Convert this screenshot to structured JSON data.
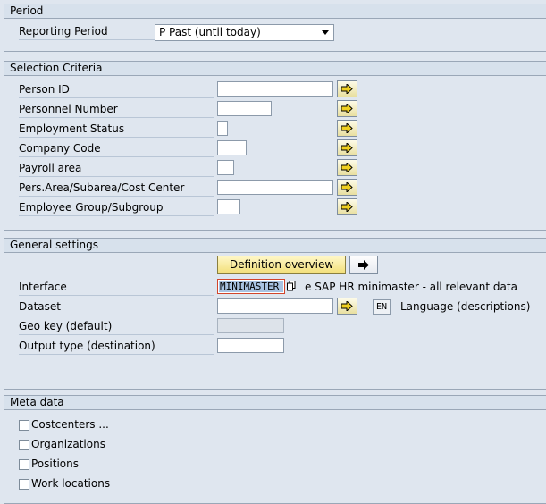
{
  "period": {
    "title": "Period",
    "reporting_period_label": "Reporting Period",
    "reporting_period_value": "P Past (until today)"
  },
  "selection": {
    "title": "Selection Criteria",
    "fields": [
      {
        "label": "Person ID",
        "value": ""
      },
      {
        "label": "Personnel Number",
        "value": ""
      },
      {
        "label": "Employment Status",
        "value": ""
      },
      {
        "label": "Company Code",
        "value": ""
      },
      {
        "label": "Payroll area",
        "value": ""
      },
      {
        "label": "Pers.Area/Subarea/Cost Center",
        "value": ""
      },
      {
        "label": "Employee Group/Subgroup",
        "value": ""
      }
    ]
  },
  "general": {
    "title": "General settings",
    "definition_button": "Definition overview",
    "interface_label": "Interface",
    "interface_value": "MINIMASTER",
    "interface_desc": "The SAP HR minimaster - all relevant data",
    "interface_desc_visible": "e SAP HR minimaster - all relevant data",
    "dataset_label": "Dataset",
    "dataset_value": "",
    "language_code": "EN",
    "language_label": "Language (descriptions)",
    "geokey_label": "Geo key (default)",
    "geokey_value": "",
    "output_label": "Output type (destination)",
    "output_value": ""
  },
  "meta": {
    "title": "Meta data",
    "items": [
      {
        "label": "Costcenters ...",
        "checked": false
      },
      {
        "label": "Organizations",
        "checked": false
      },
      {
        "label": "Positions",
        "checked": false
      },
      {
        "label": "Work locations",
        "checked": false
      }
    ]
  },
  "colors": {
    "highlight": "#a9c3e2",
    "focus_border": "#d1452c",
    "button_yellow": "#f2df79"
  },
  "icons": {
    "multi_select": "arrow-right-icon",
    "copy": "copy-icon"
  }
}
